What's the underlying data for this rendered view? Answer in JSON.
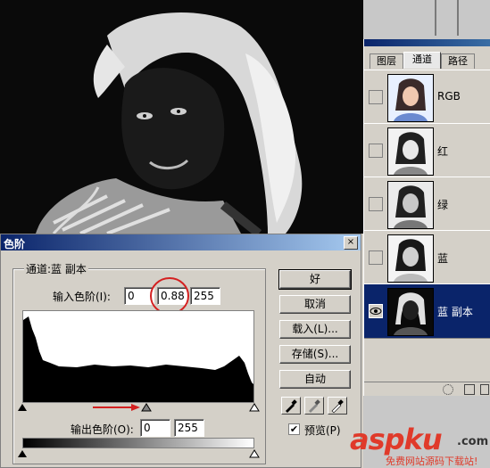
{
  "channels_panel": {
    "tabs": [
      "图层",
      "通道",
      "路径"
    ],
    "active_tab": 1,
    "rows": [
      {
        "label": "RGB",
        "selected": false
      },
      {
        "label": "红",
        "selected": false
      },
      {
        "label": "绿",
        "selected": false
      },
      {
        "label": "蓝",
        "selected": false
      },
      {
        "label": "蓝 副本",
        "selected": true
      }
    ]
  },
  "levels_dialog": {
    "title": "色阶",
    "close_label": "×",
    "channel_label": "通道:蓝 副本",
    "input_levels_label": "输入色阶(I):",
    "input_black": "0",
    "input_gamma": "0.88",
    "input_white": "255",
    "output_levels_label": "输出色阶(O):",
    "output_black": "0",
    "output_white": "255",
    "buttons": {
      "ok": "好",
      "cancel": "取消",
      "load": "载入(L)...",
      "save": "存储(S)...",
      "auto": "自动"
    },
    "preview_label": "预览(P)",
    "preview_checked": true
  },
  "watermark": {
    "brand": "aspku",
    "suffix": ".com",
    "tagline": "免费网站源码下载站!"
  },
  "colors": {
    "titlebar": "#0a246a",
    "selection": "#0a246a",
    "highlight_circle": "#d42020",
    "arrow": "#d42020"
  }
}
